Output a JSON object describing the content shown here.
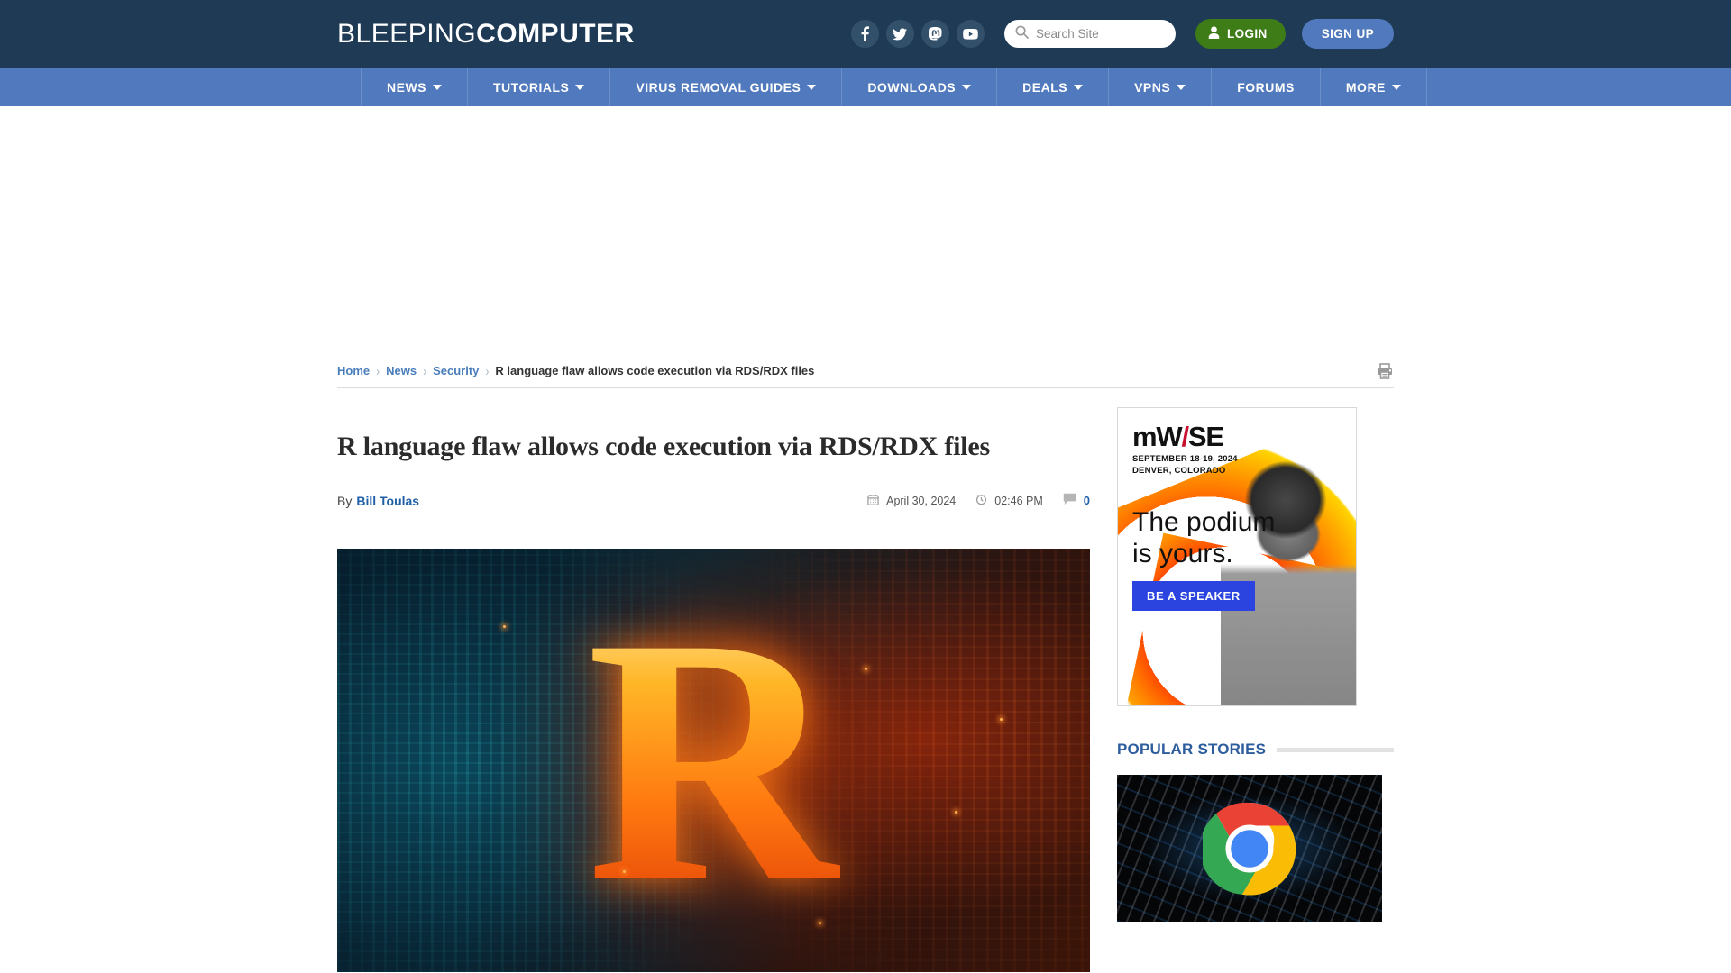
{
  "site": {
    "logo_light": "BLEEPING",
    "logo_bold": "COMPUTER",
    "brand_navy": "#1e3a55",
    "brand_blue": "#5179bd",
    "login_green": "#3e7c17"
  },
  "header": {
    "social": [
      {
        "name": "facebook-icon",
        "label": "Facebook"
      },
      {
        "name": "twitter-icon",
        "label": "Twitter"
      },
      {
        "name": "mastodon-icon",
        "label": "Mastodon"
      },
      {
        "name": "youtube-icon",
        "label": "YouTube"
      }
    ],
    "search": {
      "placeholder": "Search Site",
      "value": ""
    },
    "login_label": "LOGIN",
    "signup_label": "SIGN UP"
  },
  "nav": {
    "items": [
      {
        "label": "NEWS",
        "caret": true
      },
      {
        "label": "TUTORIALS",
        "caret": true
      },
      {
        "label": "VIRUS REMOVAL GUIDES",
        "caret": true
      },
      {
        "label": "DOWNLOADS",
        "caret": true
      },
      {
        "label": "DEALS",
        "caret": true
      },
      {
        "label": "VPNS",
        "caret": true
      },
      {
        "label": "FORUMS",
        "caret": false
      },
      {
        "label": "MORE",
        "caret": true
      }
    ]
  },
  "breadcrumb": {
    "items": [
      {
        "label": "Home",
        "link": true
      },
      {
        "label": "News",
        "link": true
      },
      {
        "label": "Security",
        "link": true
      },
      {
        "label": "R language flaw allows code execution via RDS/RDX files",
        "link": false
      }
    ],
    "separator": "›",
    "print_icon": "printer-icon"
  },
  "article": {
    "title": "R language flaw allows code execution via RDS/RDX files",
    "by_label": "By",
    "author": "Bill Toulas",
    "date": "April 30, 2024",
    "time": "02:46 PM",
    "comment_count": "0",
    "hero_letter": "R",
    "hero_alt": "Flaming letter R over digital circuit background"
  },
  "sidebar": {
    "ad": {
      "brand_m": "m",
      "brand_w": "W",
      "brand_slash": "/",
      "brand_ise": "SE",
      "dates": "SEPTEMBER 18-19, 2024",
      "location": "DENVER, COLORADO",
      "headline_line1": "The podium",
      "headline_line2": "is yours.",
      "cta_label": "BE A SPEAKER",
      "cta_color": "#2b44e0"
    },
    "popular": {
      "title": "POPULAR STORIES",
      "thumb_alt": "Google Chrome logo over dark matrix background"
    }
  }
}
